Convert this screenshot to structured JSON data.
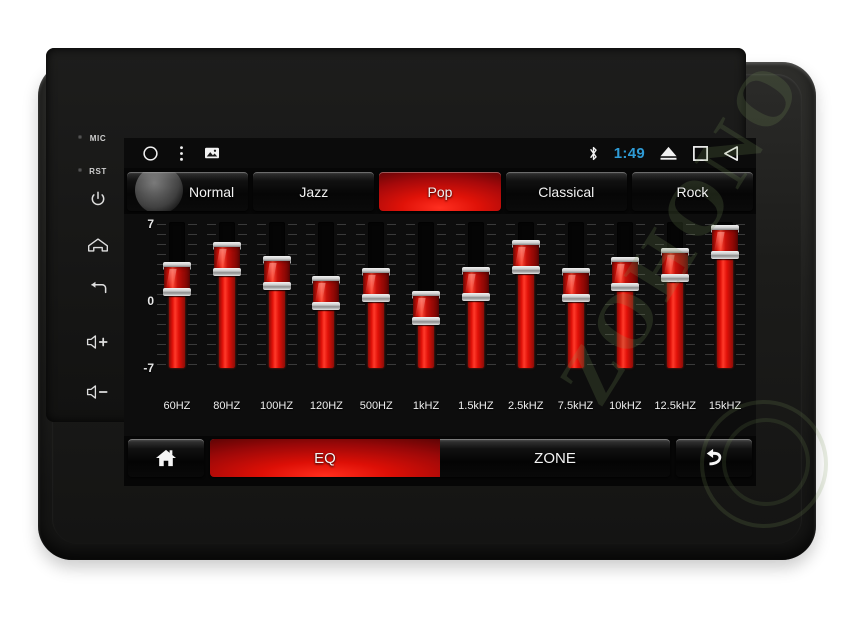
{
  "device": {
    "name": "car-stereo-head-unit",
    "watermark": "ZOHONO"
  },
  "hardware_buttons": [
    {
      "id": "mic",
      "label": "MIC",
      "icon": "mic-pinhole-icon"
    },
    {
      "id": "rst",
      "label": "RST",
      "icon": "reset-pinhole-icon"
    },
    {
      "id": "power",
      "label": "",
      "icon": "power-icon"
    },
    {
      "id": "home",
      "label": "",
      "icon": "home-icon"
    },
    {
      "id": "back",
      "label": "",
      "icon": "back-arrow-icon"
    },
    {
      "id": "volume-up",
      "label": "",
      "icon": "volume-up-icon"
    },
    {
      "id": "volume-down",
      "label": "",
      "icon": "volume-down-icon"
    }
  ],
  "statusbar": {
    "left_icons": [
      "circle-icon",
      "overflow-menu-icon",
      "image-icon"
    ],
    "bluetooth_icon": "bluetooth-icon",
    "time": "1:49",
    "nav_icons": [
      "eject-triangle-icon",
      "square-icon",
      "back-triangle-icon"
    ],
    "clock_color": "#2e9bd6"
  },
  "presets": {
    "active": "Pop",
    "items": [
      {
        "label": "Normal",
        "active": false
      },
      {
        "label": "Jazz",
        "active": false
      },
      {
        "label": "Pop",
        "active": true
      },
      {
        "label": "Classical",
        "active": false
      },
      {
        "label": "Rock",
        "active": false
      }
    ]
  },
  "equalizer": {
    "axis_labels": {
      "top": "7",
      "middle": "0",
      "bottom": "-7"
    },
    "range": [
      -7,
      7
    ],
    "accent_color": "#e01008",
    "bands": [
      {
        "freq": "60HZ",
        "value": 2.0
      },
      {
        "freq": "80HZ",
        "value": 4.5
      },
      {
        "freq": "100HZ",
        "value": 2.8
      },
      {
        "freq": "120HZ",
        "value": 0.2
      },
      {
        "freq": "500HZ",
        "value": 1.2
      },
      {
        "freq": "1kHZ",
        "value": -1.6
      },
      {
        "freq": "1.5kHZ",
        "value": 1.4
      },
      {
        "freq": "2.5kHZ",
        "value": 4.8
      },
      {
        "freq": "7.5kHZ",
        "value": 1.3
      },
      {
        "freq": "10kHZ",
        "value": 2.6
      },
      {
        "freq": "12.5kHZ",
        "value": 3.8
      },
      {
        "freq": "15kHZ",
        "value": 6.6
      }
    ]
  },
  "bottombar": {
    "home_icon": "home-icon",
    "back_icon": "back-arrow-icon",
    "tabs": [
      {
        "label": "EQ",
        "active": true
      },
      {
        "label": "ZONE",
        "active": false
      }
    ]
  }
}
